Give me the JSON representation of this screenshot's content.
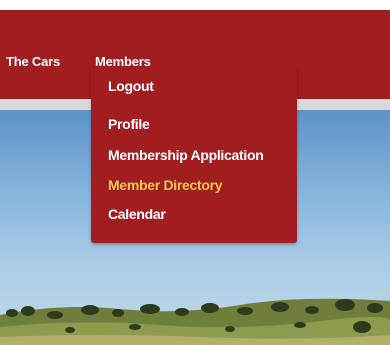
{
  "nav": {
    "items": [
      "The Cars",
      "Members"
    ]
  },
  "dropdown": {
    "items": [
      {
        "label": "Logout"
      },
      {
        "label": "Profile"
      },
      {
        "label": "Membership Application"
      },
      {
        "label": "Member Directory",
        "active": true
      },
      {
        "label": "Calendar"
      }
    ]
  },
  "colors": {
    "brand_red": "#a11d1f",
    "active_item": "#f2c94c"
  }
}
